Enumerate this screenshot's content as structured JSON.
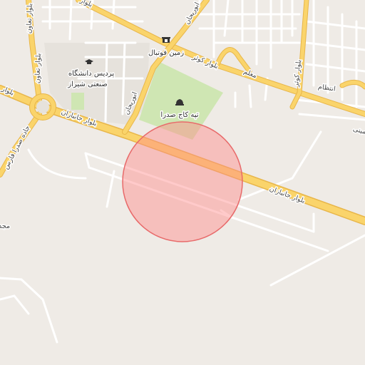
{
  "map": {
    "colors": {
      "background": "#efebe6",
      "major_road": "#fad46b",
      "major_road_casing": "#e8b64a",
      "minor_road": "#ffffff",
      "park": "#cfe6b3",
      "campus": "#e6e2dc",
      "radius_fill": "#ff8a8a",
      "radius_stroke": "#e86a6a"
    },
    "labels": {
      "football_field": "زمین فوتبال",
      "kaj_hill": "تپه کاج صدرا",
      "university_line1": "پردیس دانشگاه",
      "university_line2": "صنعتی شیراز",
      "janbazan_1": "بلوار جانبازان",
      "janbazan_2": "بلوار جانبازان",
      "kowsar": "بلوار کوثر",
      "moallem": "معلم",
      "entezam": "انتظام",
      "abureyhan_1": "ابوریحان",
      "abureyhan_2": "ابوریحان",
      "taavon_1": "بلوار تعاون",
      "taavon_2": "بلوار تعاون",
      "sadra_road": "جاده صدرا فارس",
      "blvd_left": "بلوار",
      "blvd_top": "بلوار",
      "right_edge": "امینی",
      "right_vertical": "بلوار کوثر",
      "left_edge": "مجد"
    },
    "icons": {
      "stadium": "stadium-icon",
      "university": "graduation-cap-icon",
      "landmark": "landmark-icon"
    },
    "overlay": {
      "type": "radius-circle"
    }
  }
}
